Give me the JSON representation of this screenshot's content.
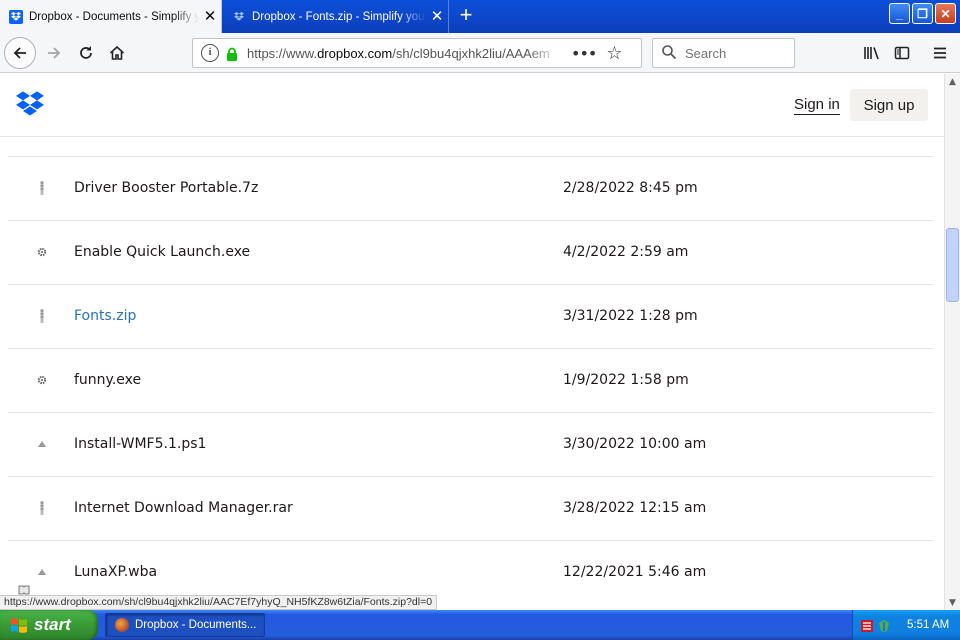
{
  "browser": {
    "tabs": [
      {
        "title": "Dropbox - Documents - Simplify yo",
        "active": true
      },
      {
        "title": "Dropbox - Fonts.zip - Simplify you",
        "active": false
      }
    ],
    "new_tab_label": "+",
    "window_buttons": {
      "minimize": "_",
      "restore": "❐",
      "close": "✕"
    },
    "url": {
      "scheme": "https://www.",
      "domain": "dropbox.com",
      "path": "/sh/cl9bu4qjxhk2liu/AAAem"
    },
    "search_placeholder": "Search"
  },
  "site": {
    "sign_in": "Sign in",
    "sign_up": "Sign up"
  },
  "files": [
    {
      "name": "Driver Booster Portable.7z",
      "date": "2/28/2022 8:45 pm",
      "icon": "archive-icon",
      "link": false
    },
    {
      "name": "Enable Quick Launch.exe",
      "date": "4/2/2022 2:59 am",
      "icon": "gear-icon",
      "link": false
    },
    {
      "name": "Fonts.zip",
      "date": "3/31/2022 1:28 pm",
      "icon": "archive-icon",
      "link": true
    },
    {
      "name": "funny.exe",
      "date": "1/9/2022 1:58 pm",
      "icon": "gear-icon",
      "link": false
    },
    {
      "name": "Install-WMF5.1.ps1",
      "date": "3/30/2022 10:00 am",
      "icon": "script-icon",
      "link": false
    },
    {
      "name": "Internet Download Manager.rar",
      "date": "3/28/2022 12:15 am",
      "icon": "archive-icon",
      "link": false
    },
    {
      "name": "LunaXP.wba",
      "date": "12/22/2021 5:46 am",
      "icon": "script-icon",
      "link": false
    }
  ],
  "status_link": "https://www.dropbox.com/sh/cl9bu4qjxhk2liu/AAC7Ef7yhyQ_NH5fKZ8w6tZia/Fonts.zip?dl=0",
  "taskbar": {
    "start_label": "start",
    "task_item": "Dropbox - Documents...",
    "clock": "5:51 AM"
  },
  "colors": {
    "link": "#2a6fb8",
    "dropbox_blue": "#0061fe",
    "xp_taskbar": "#245ddb",
    "xp_start": "#3a9a36"
  }
}
